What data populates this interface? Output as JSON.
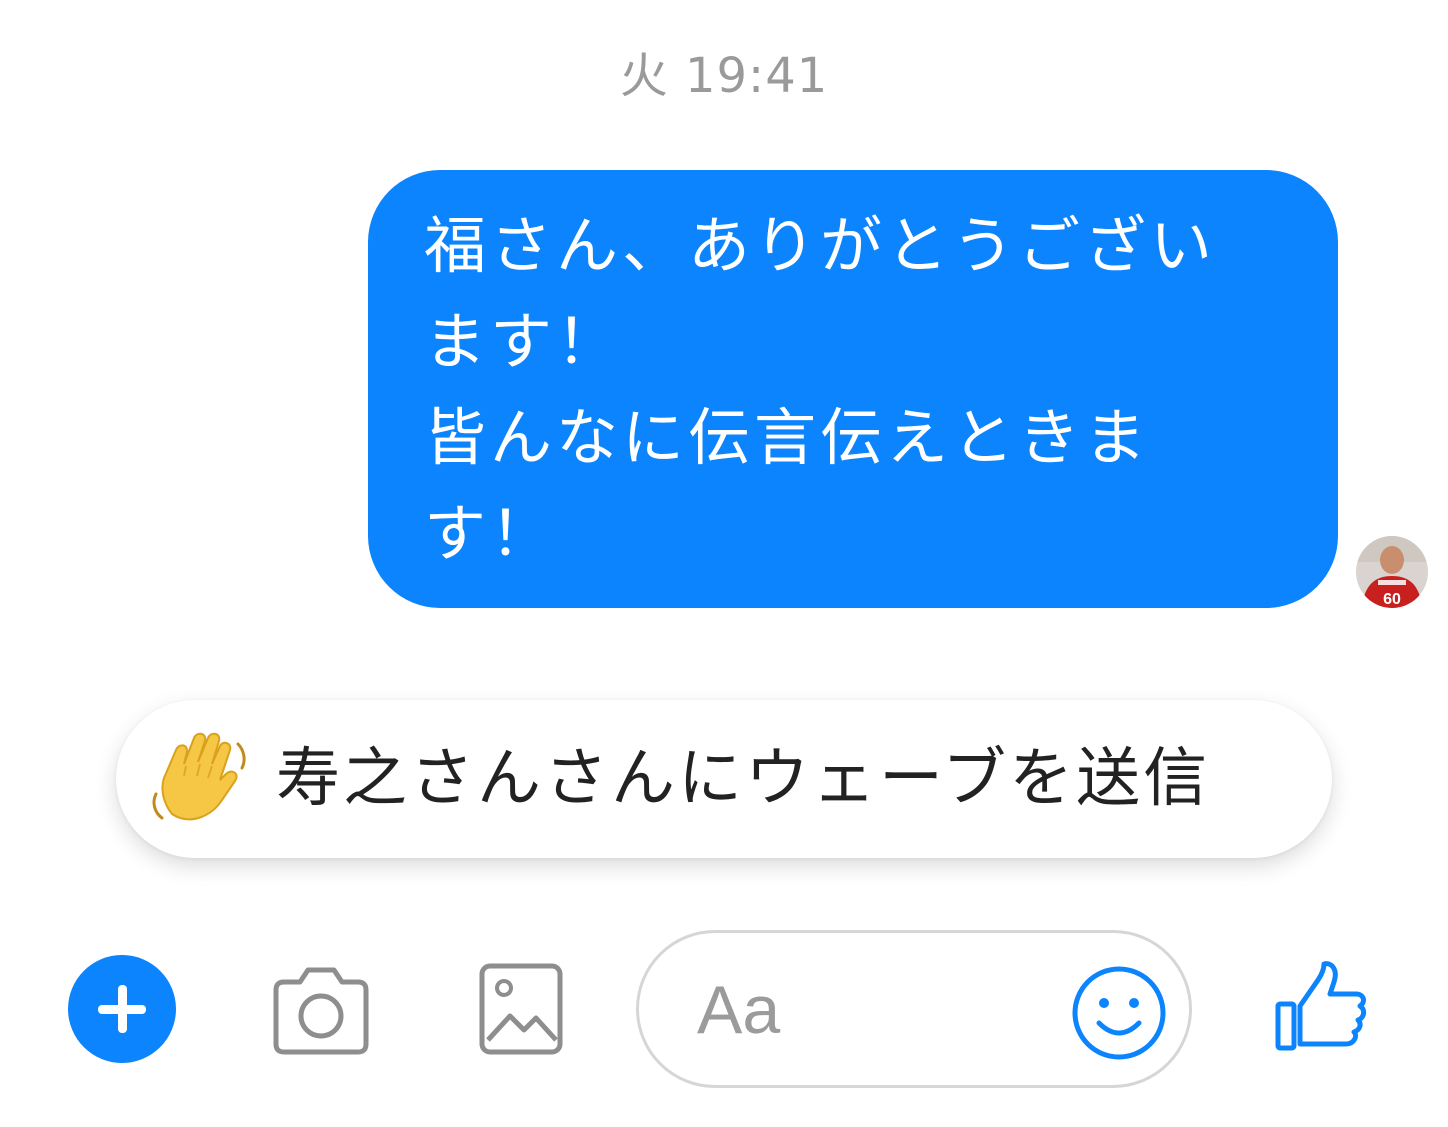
{
  "conversation": {
    "timestamp": "火 19:41",
    "message": {
      "lines": [
        "福さん、ありがとうござい",
        "ます！",
        "皆んなに伝言伝えときま",
        "す！"
      ]
    },
    "wave_card": {
      "text": "寿之さんさんにウェーブを送信"
    }
  },
  "composer": {
    "placeholder": "Aa",
    "icons": {
      "plus": "plus-icon",
      "camera": "camera-icon",
      "photo": "image-icon",
      "emoji": "smiley-icon",
      "like": "thumbs-up-icon"
    }
  },
  "colors": {
    "accent": "#0b84fe",
    "bubble_text": "#ffffff",
    "timestamp": "#9a9a9a",
    "icon_gray": "#8e8e8e"
  }
}
